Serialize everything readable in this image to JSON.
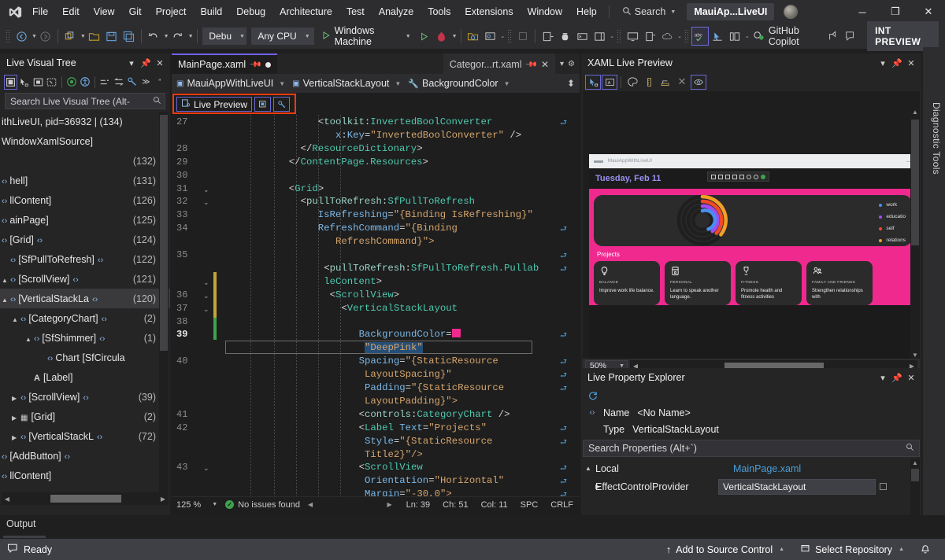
{
  "titlebar": {
    "logo_icon": "visual-studio-logo",
    "menus": [
      "File",
      "Edit",
      "View",
      "Git",
      "Project",
      "Build",
      "Debug",
      "Architecture",
      "Test",
      "Analyze",
      "Tools",
      "Extensions",
      "Window",
      "Help"
    ],
    "search_label": "Search",
    "search_icon": "search-icon",
    "solution_name": "MauiAp...LiveUI",
    "avatar_name": "user-avatar",
    "minimize": "─",
    "restore": "❐",
    "close": "✕"
  },
  "toolbar": {
    "nav_back_icon": "navigate-back-icon",
    "nav_forward_icon": "navigate-forward-icon",
    "new_project_icon": "new-project-icon",
    "open_icon": "open-file-icon",
    "save_icon": "save-icon",
    "save_all_icon": "save-all-icon",
    "undo_icon": "undo-icon",
    "redo_icon": "redo-icon",
    "configuration": "Debu",
    "platform": "Any CPU",
    "run_target": "Windows Machine",
    "run_icon": "play-icon",
    "hot_reload_icon": "hot-reload-icon",
    "copilot_label": "GitHub Copilot",
    "copilot_icon": "copilot-icon",
    "int_preview": "INT PREVIEW",
    "spell_check_icon": "spell-check-icon"
  },
  "live_visual_tree": {
    "title": "Live Visual Tree",
    "search_placeholder": "Search Live Visual Tree (Alt-",
    "search_icon": "search-icon",
    "toolbar_icons": [
      "select-element-icon",
      "pick-element-icon",
      "display-layout-icon",
      "track-focus-icon",
      "preview-selection-icon",
      "accessibility-icon",
      "show-properties-icon",
      "swap-icon",
      "live-properties-icon",
      "overflow-chevron-icon"
    ],
    "rows": [
      {
        "indent": 0,
        "label": "ithLiveUI, pid=36932 | (134)",
        "count": "",
        "icon": "",
        "twisty": ""
      },
      {
        "indent": 0,
        "label": "WindowXamlSource]",
        "count": "",
        "icon": "",
        "twisty": ""
      },
      {
        "indent": 0,
        "label": "",
        "count": "(132)",
        "icon": "",
        "twisty": ""
      },
      {
        "indent": 0,
        "label": "hell]",
        "count": "(131)",
        "icon": "tag",
        "twisty": ""
      },
      {
        "indent": 0,
        "label": "llContent]",
        "count": "(126)",
        "icon": "tag",
        "twisty": ""
      },
      {
        "indent": 0,
        "label": "ainPage]",
        "count": "(125)",
        "icon": "tag",
        "twisty": ""
      },
      {
        "indent": 0,
        "label": "[Grid]",
        "count": "(124)",
        "icon": "tag",
        "twisty": ""
      },
      {
        "indent": 1,
        "label": "[SfPullToRefresh]",
        "count": "(122)",
        "icon": "tag-both",
        "twisty": ""
      },
      {
        "indent": 1,
        "label": "[ScrollView]",
        "count": "(121)",
        "icon": "tag-both",
        "twisty": "open"
      },
      {
        "indent": 2,
        "label": "[VerticalStackLa",
        "count": "(120)",
        "icon": "tag",
        "twisty": "open",
        "selected": true
      },
      {
        "indent": 3,
        "label": "[CategoryChart]",
        "count": "(2)",
        "icon": "tag",
        "twisty": "open"
      },
      {
        "indent": 4,
        "label": "[SfShimmer]",
        "count": "(1)",
        "icon": "tag",
        "twisty": "open"
      },
      {
        "indent": 5,
        "label": "Chart [SfCircula",
        "count": "",
        "icon": "tag",
        "twisty": ""
      },
      {
        "indent": 4,
        "label": "[Label]",
        "count": "",
        "icon": "label-A",
        "twisty": ""
      },
      {
        "indent": 3,
        "label": "[ScrollView]",
        "count": "(39)",
        "icon": "tag",
        "twisty": "closed"
      },
      {
        "indent": 3,
        "label": "[Grid]",
        "count": "(2)",
        "icon": "grid",
        "twisty": "closed"
      },
      {
        "indent": 3,
        "label": "[VerticalStackL",
        "count": "(72)",
        "icon": "tag",
        "twisty": "closed"
      },
      {
        "indent": 0,
        "label": "[AddButton]",
        "count": "",
        "icon": "tag",
        "twisty": ""
      },
      {
        "indent": 0,
        "label": "llContent]",
        "count": "",
        "icon": "tag",
        "twisty": ""
      }
    ]
  },
  "editor": {
    "tabs": [
      {
        "label": "MainPage.xaml",
        "active": true,
        "pinned": true,
        "modified": true
      },
      {
        "label": "Categor...rt.xaml",
        "active": false,
        "pinned": true,
        "closable": true
      }
    ],
    "breadcrumb": [
      {
        "label": "MauiAppWithLiveUI",
        "icon": "xaml-file-icon"
      },
      {
        "label": "VerticalStackLayout",
        "icon": "element-icon"
      },
      {
        "label": "BackgroundColor",
        "icon": "property-wrench-icon"
      }
    ],
    "live_preview_button": "Live Preview",
    "live_preview_icon": "live-preview-icon",
    "lp_tool_icons": [
      "select-element-icon",
      "live-properties-icon"
    ],
    "code_lines": [
      {
        "num": "27",
        "fold": "",
        "indent": 17,
        "tokens": [
          [
            "punc",
            "<"
          ],
          [
            "ns",
            "toolkit"
          ],
          [
            "punc",
            ":"
          ],
          [
            "elem",
            "InvertedBoolConverter"
          ]
        ],
        "wrap": true
      },
      {
        "num": "",
        "fold": "",
        "indent": 20,
        "tokens": [
          [
            "attr",
            "x"
          ],
          [
            "punc",
            ":"
          ],
          [
            "attr",
            "Key"
          ],
          [
            "punc",
            "="
          ],
          [
            "str",
            "\"InvertedBoolConverter\""
          ],
          [
            "punc",
            " />"
          ]
        ]
      },
      {
        "num": "28",
        "fold": "",
        "indent": 14,
        "tokens": [
          [
            "punc",
            "</"
          ],
          [
            "elem",
            "ResourceDictionary"
          ],
          [
            "punc",
            ">"
          ]
        ]
      },
      {
        "num": "29",
        "fold": "",
        "indent": 12,
        "tokens": [
          [
            "punc",
            "</"
          ],
          [
            "elem",
            "ContentPage.Resources"
          ],
          [
            "punc",
            ">"
          ]
        ]
      },
      {
        "num": "30",
        "fold": "",
        "indent": 0,
        "tokens": []
      },
      {
        "num": "31",
        "fold": "v",
        "indent": 12,
        "tokens": [
          [
            "punc",
            "<"
          ],
          [
            "elem",
            "Grid"
          ],
          [
            "punc",
            ">"
          ]
        ]
      },
      {
        "num": "32",
        "fold": "v",
        "indent": 14,
        "tokens": [
          [
            "punc",
            "<"
          ],
          [
            "ns",
            "pullToRefresh"
          ],
          [
            "punc",
            ":"
          ],
          [
            "elem",
            "SfPullToRefresh"
          ]
        ]
      },
      {
        "num": "33",
        "fold": "",
        "indent": 17,
        "tokens": [
          [
            "attr",
            "IsRefreshing"
          ],
          [
            "punc",
            "="
          ],
          [
            "str",
            "\"{Binding IsRefreshing}\""
          ]
        ]
      },
      {
        "num": "34",
        "fold": "",
        "indent": 17,
        "tokens": [
          [
            "attr",
            "RefreshCommand"
          ],
          [
            "punc",
            "="
          ],
          [
            "str",
            "\"{Binding"
          ]
        ],
        "wrap": true
      },
      {
        "num": "",
        "fold": "",
        "indent": 20,
        "tokens": [
          [
            "str",
            "RefreshCommand}\">"
          ]
        ]
      },
      {
        "num": "35",
        "fold": "",
        "indent": 0,
        "tokens": [],
        "wrap": true
      },
      {
        "num": "",
        "fold": "",
        "indent": 18,
        "tokens": [
          [
            "punc",
            "<"
          ],
          [
            "ns",
            "pullToRefresh"
          ],
          [
            "punc",
            ":"
          ],
          [
            "elem",
            "SfPullToRefresh.Pullab"
          ]
        ],
        "wrap": true
      },
      {
        "num": "",
        "fold": "v",
        "indent": 18,
        "tokens": [
          [
            "elem",
            "leContent"
          ],
          [
            "punc",
            ">"
          ]
        ]
      },
      {
        "num": "36",
        "fold": "v",
        "indent": 19,
        "tokens": [
          [
            "punc",
            "<"
          ],
          [
            "elem",
            "ScrollView"
          ],
          [
            "punc",
            ">"
          ]
        ]
      },
      {
        "num": "37",
        "fold": "v",
        "indent": 21,
        "tokens": [
          [
            "punc",
            "<"
          ],
          [
            "elem",
            "VerticalStackLayout"
          ]
        ]
      },
      {
        "num": "38",
        "fold": "",
        "indent": 0,
        "tokens": []
      },
      {
        "num": "39",
        "fold": "",
        "indent": 24,
        "tokens": [
          [
            "attr",
            "BackgroundColor"
          ],
          [
            "punc",
            "="
          ],
          [
            "swatch",
            "#f0298f"
          ]
        ],
        "current": true,
        "wrap": true
      },
      {
        "num": "",
        "fold": "",
        "indent": 25,
        "tokens": [
          [
            "selstr",
            "\"DeepPink\""
          ]
        ],
        "selection_box": true
      },
      {
        "num": "40",
        "fold": "",
        "indent": 24,
        "tokens": [
          [
            "attr",
            "Spacing"
          ],
          [
            "punc",
            "="
          ],
          [
            "str",
            "\"{StaticResource"
          ]
        ],
        "wrap": true
      },
      {
        "num": "",
        "fold": "",
        "indent": 25,
        "tokens": [
          [
            "str",
            "LayoutSpacing}\""
          ]
        ],
        "wrap": true
      },
      {
        "num": "",
        "fold": "",
        "indent": 25,
        "tokens": [
          [
            "attr",
            "Padding"
          ],
          [
            "punc",
            "="
          ],
          [
            "str",
            "\"{StaticResource"
          ]
        ],
        "wrap": true
      },
      {
        "num": "",
        "fold": "",
        "indent": 25,
        "tokens": [
          [
            "str",
            "LayoutPadding}\">"
          ]
        ]
      },
      {
        "num": "41",
        "fold": "",
        "indent": 24,
        "tokens": [
          [
            "punc",
            "<"
          ],
          [
            "ns",
            "controls"
          ],
          [
            "punc",
            ":"
          ],
          [
            "elem",
            "CategoryChart"
          ],
          [
            "punc",
            " />"
          ]
        ]
      },
      {
        "num": "42",
        "fold": "",
        "indent": 24,
        "tokens": [
          [
            "punc",
            "<"
          ],
          [
            "elem",
            "Label"
          ],
          [
            "punc",
            " "
          ],
          [
            "attr",
            "Text"
          ],
          [
            "punc",
            "="
          ],
          [
            "str",
            "\"Projects\""
          ]
        ],
        "wrap": true
      },
      {
        "num": "",
        "fold": "",
        "indent": 25,
        "tokens": [
          [
            "attr",
            "Style"
          ],
          [
            "punc",
            "="
          ],
          [
            "str",
            "\"{StaticResource"
          ]
        ],
        "wrap": true
      },
      {
        "num": "",
        "fold": "",
        "indent": 25,
        "tokens": [
          [
            "str",
            "Title2}\"/>"
          ]
        ]
      },
      {
        "num": "43",
        "fold": "v",
        "indent": 24,
        "tokens": [
          [
            "punc",
            "<"
          ],
          [
            "elem",
            "ScrollView"
          ]
        ],
        "wrap": true
      },
      {
        "num": "",
        "fold": "",
        "indent": 25,
        "tokens": [
          [
            "attr",
            "Orientation"
          ],
          [
            "punc",
            "="
          ],
          [
            "str",
            "\"Horizontal\""
          ]
        ],
        "wrap": true
      },
      {
        "num": "",
        "fold": "",
        "indent": 25,
        "tokens": [
          [
            "attr",
            "Margin"
          ],
          [
            "punc",
            "="
          ],
          [
            "str",
            "\"-30,0\">"
          ]
        ],
        "wrap": true
      }
    ],
    "status": {
      "zoom": "125 %",
      "issues": "No issues found",
      "ln": "Ln: 39",
      "ch": "Ch: 51",
      "col": "Col: 11",
      "spaces": "SPC",
      "eol": "CRLF"
    }
  },
  "xaml_live_preview": {
    "title": "XAML Live Preview",
    "toolbar_icons": [
      "select-element-icon",
      "show-annotations-icon",
      "color-picker-icon",
      "ruler-icon",
      "layout-icon",
      "clear-icon",
      "eye-icon"
    ],
    "device": {
      "window_title": "MauiAppWithLiveUI",
      "date": "Tuesday, Feb 11",
      "projects_label": "Projects",
      "chart": {
        "legend": [
          {
            "label": "work",
            "color": "#4a8ef0"
          },
          {
            "label": "educatio",
            "color": "#a34df0"
          },
          {
            "label": "self",
            "color": "#f04a28"
          },
          {
            "label": "relations",
            "color": "#f0a028"
          }
        ],
        "arcs": [
          {
            "name": "relations",
            "color": "#f0a028",
            "radius": 30,
            "sweep": 118
          },
          {
            "name": "self",
            "color": "#f04a28",
            "radius": 24,
            "sweep": 100
          },
          {
            "name": "education",
            "color": "#a34df0",
            "radius": 18,
            "sweep": 90
          },
          {
            "name": "work",
            "color": "#4a8ef0",
            "radius": 12,
            "sweep": 78
          }
        ]
      },
      "cards": [
        {
          "icon": "lightbulb-icon",
          "category": "BALANCE",
          "desc": "Improve work  life balance."
        },
        {
          "icon": "book-icon",
          "category": "PERSONAL",
          "desc": "Learn to speak another language."
        },
        {
          "icon": "trophy-icon",
          "category": "FITNESS",
          "desc": "Promote health and fitness activities"
        },
        {
          "icon": "people-icon",
          "category": "FAMILY AND FRIENDS",
          "desc": "Strengthen relationships with"
        }
      ]
    },
    "zoom": "50%"
  },
  "live_property_explorer": {
    "title": "Live Property Explorer",
    "refresh_icon": "refresh-icon",
    "name_key": "Name",
    "name_value": "<No Name>",
    "type_key": "Type",
    "type_value": "VerticalStackLayout",
    "search_placeholder": "Search Properties (Alt+`)",
    "search_icon": "search-icon",
    "group_label": "Local",
    "group_source": "MainPage.xaml",
    "rows": [
      {
        "name": "EffectControlProvider",
        "value": "VerticalStackLayout"
      }
    ]
  },
  "output": {
    "tab_label": "Output"
  },
  "statusbar": {
    "ready": "Ready",
    "ready_icon": "feedback-icon",
    "add_to_source_control": "Add to Source Control",
    "add_icon": "arrow-up-icon",
    "select_repository": "Select Repository",
    "repo_icon": "repository-icon",
    "bell_icon": "notification-bell-icon"
  },
  "diagnostic_tools": {
    "label": "Diagnostic Tools"
  }
}
